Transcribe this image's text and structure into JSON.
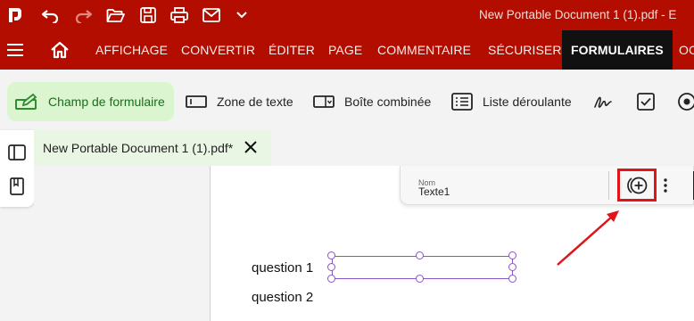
{
  "window": {
    "title": "New Portable Document 1 (1).pdf - E"
  },
  "quick_access": [
    "app-logo-icon",
    "undo-icon",
    "redo-icon",
    "open-folder-icon",
    "save-icon",
    "print-icon",
    "mail-icon",
    "chevron-down-icon"
  ],
  "menu": {
    "tabs": [
      {
        "label": "AFFICHAGE"
      },
      {
        "label": "CONVERTIR"
      },
      {
        "label": "ÉDITER"
      },
      {
        "label": "PAGE"
      },
      {
        "label": "COMMENTAIRE"
      },
      {
        "label": "SÉCURISER"
      },
      {
        "label": "FORMULAIRES"
      },
      {
        "label": "OC"
      }
    ],
    "active_tab": "FORMULAIRES"
  },
  "toolbar": {
    "form_field": "Champ de formulaire",
    "text_field": "Zone de texte",
    "combo_box": "Boîte combinée",
    "list_box": "Liste déroulante"
  },
  "document_tab": {
    "label": "New Portable Document 1 (1).pdf*"
  },
  "property_bar": {
    "name_label": "Nom",
    "name_value": "Texte1"
  },
  "page": {
    "question_1": "question 1",
    "question_2": "question 2"
  },
  "colors": {
    "brand_red": "#b30d00",
    "active_tab_bg": "#111111",
    "field_border": "#8a55c8",
    "highlight_red": "#e0141b",
    "active_tool_bg": "#dbf5d0"
  }
}
